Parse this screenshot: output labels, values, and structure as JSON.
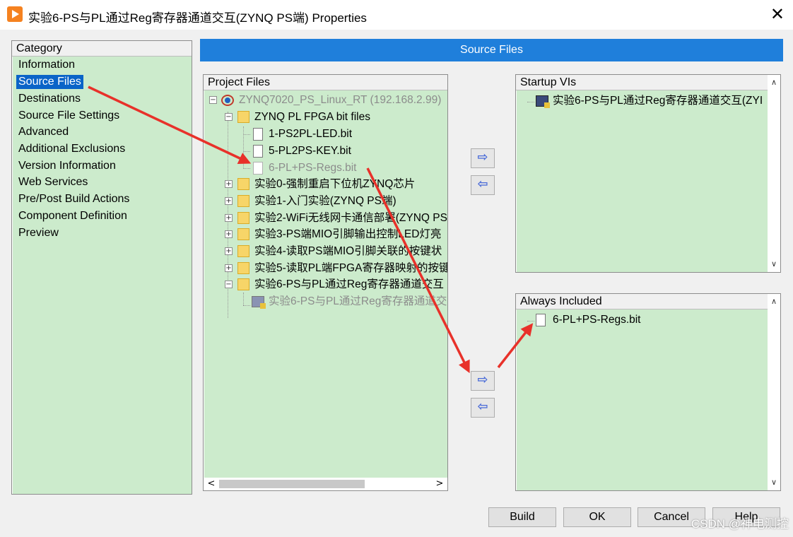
{
  "window": {
    "title": "实验6-PS与PL通过Reg寄存器通道交互(ZYNQ PS端) Properties",
    "close_symbol": "✕"
  },
  "category": {
    "header": "Category",
    "items": [
      {
        "label": "Information",
        "selected": false
      },
      {
        "label": "Source Files",
        "selected": true
      },
      {
        "label": "Destinations",
        "selected": false
      },
      {
        "label": "Source File Settings",
        "selected": false
      },
      {
        "label": "Advanced",
        "selected": false
      },
      {
        "label": "Additional Exclusions",
        "selected": false
      },
      {
        "label": "Version Information",
        "selected": false
      },
      {
        "label": "Web Services",
        "selected": false
      },
      {
        "label": "Pre/Post Build Actions",
        "selected": false
      },
      {
        "label": "Component Definition",
        "selected": false
      },
      {
        "label": "Preview",
        "selected": false
      }
    ]
  },
  "banner": {
    "title": "Source Files"
  },
  "project_files": {
    "header": "Project Files",
    "rows": [
      {
        "label": "ZYNQ7020_PS_Linux_RT (192.168.2.99)",
        "icon": "target-icon",
        "expander": "−",
        "gray": true
      },
      {
        "label": "ZYNQ PL FPGA bit files",
        "icon": "folder-icon",
        "expander": "−",
        "gray": false
      },
      {
        "label": "1-PS2PL-LED.bit",
        "icon": "file-icon",
        "expander": "",
        "gray": false
      },
      {
        "label": "5-PL2PS-KEY.bit",
        "icon": "file-icon",
        "expander": "",
        "gray": false
      },
      {
        "label": "6-PL+PS-Regs.bit",
        "icon": "file-icon",
        "expander": "",
        "gray": true
      },
      {
        "label": "实验0-强制重启下位机ZYNQ芯片",
        "icon": "folder-icon",
        "expander": "+",
        "gray": false
      },
      {
        "label": "实验1-入门实验(ZYNQ PS端)",
        "icon": "folder-icon",
        "expander": "+",
        "gray": false
      },
      {
        "label": "实验2-WiFi无线网卡通信部署(ZYNQ PS",
        "icon": "folder-icon",
        "expander": "+",
        "gray": false
      },
      {
        "label": "实验3-PS端MIO引脚输出控制LED灯亮",
        "icon": "folder-icon",
        "expander": "+",
        "gray": false
      },
      {
        "label": "实验4-读取PS端MIO引脚关联的按键状",
        "icon": "folder-icon",
        "expander": "+",
        "gray": false
      },
      {
        "label": "实验5-读取PL端FPGA寄存器映射的按键",
        "icon": "folder-icon",
        "expander": "+",
        "gray": false
      },
      {
        "label": "实验6-PS与PL通过Reg寄存器通道交互",
        "icon": "folder-icon",
        "expander": "−",
        "gray": false
      },
      {
        "label": "实验6-PS与PL通过Reg寄存器通道交",
        "icon": "vi-icon",
        "expander": "",
        "gray": true
      }
    ]
  },
  "startup_vis": {
    "header": "Startup VIs",
    "rows": [
      {
        "label": "实验6-PS与PL通过Reg寄存器通道交互(ZYI",
        "icon": "vi-icon"
      }
    ]
  },
  "always_included": {
    "header": "Always Included",
    "rows": [
      {
        "label": "6-PL+PS-Regs.bit",
        "icon": "file-icon"
      }
    ]
  },
  "transfer_buttons": {
    "add": "⇨",
    "remove": "⇦"
  },
  "scroll": {
    "up": "∧",
    "down": "∨",
    "left": "<",
    "right": ">"
  },
  "buttons": {
    "build": "Build",
    "ok": "OK",
    "cancel": "Cancel",
    "help": "Help"
  },
  "watermark": "CSDN @神电测控",
  "colors": {
    "panel_bg": "#ccebcc",
    "banner": "#1f7fdb",
    "selection": "#0a64c8",
    "annotation": "#e8312a"
  }
}
